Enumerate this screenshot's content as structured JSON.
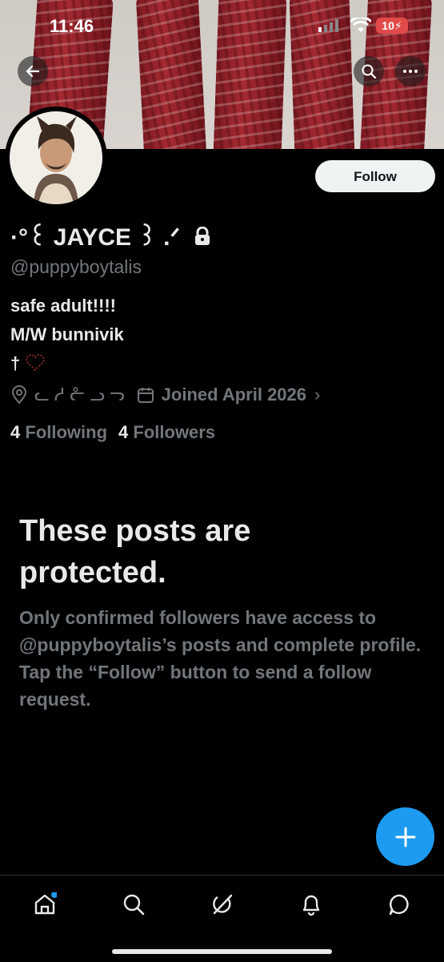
{
  "status_bar": {
    "time": "11:46",
    "battery": "10"
  },
  "header": {
    "back_icon": "arrow-left-icon",
    "search_icon": "search-icon",
    "more_icon": "more-icon"
  },
  "profile": {
    "display_name": "·°꒰ JAYCE ꒱ .ᐟ",
    "handle": "@puppyboytalis",
    "follow_label": "Follow",
    "bio_lines": [
      "safe adult!!!!",
      "M/W bunnivik",
      "†"
    ],
    "location": "ᓚ ᓱ ᓔ ᓗ ᓓ",
    "joined": "Joined April 2026",
    "following_count": "4",
    "following_label": "Following",
    "followers_count": "4",
    "followers_label": "Followers"
  },
  "protected": {
    "title": "These posts are protected.",
    "body": "Only confirmed followers have access to @puppyboytalis’s posts and complete profile. Tap the “Follow” button to send a follow request."
  },
  "tabbar": {
    "items": [
      "home-icon",
      "search-icon",
      "grok-icon",
      "notifications-icon",
      "messages-icon"
    ]
  },
  "colors": {
    "accent": "#1d9bf0",
    "muted": "#71767b",
    "text": "#e7e9ea",
    "background": "#000000"
  }
}
